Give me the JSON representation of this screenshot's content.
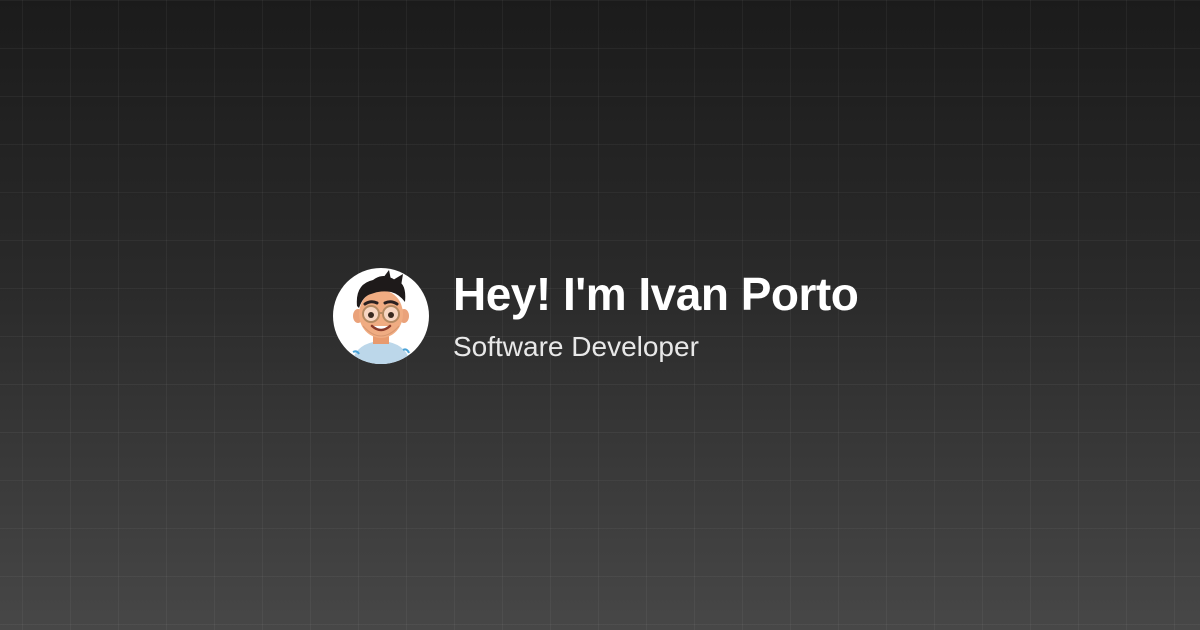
{
  "profile": {
    "greeting": "Hey! I'm Ivan Porto",
    "role": "Software Developer",
    "avatar_icon": "memoji-avatar-icon"
  },
  "colors": {
    "background_top": "#1b1b1b",
    "background_bottom": "#474747",
    "title": "#ffffff",
    "subtitle": "#e8e8e8",
    "avatar_background": "#ffffff"
  }
}
